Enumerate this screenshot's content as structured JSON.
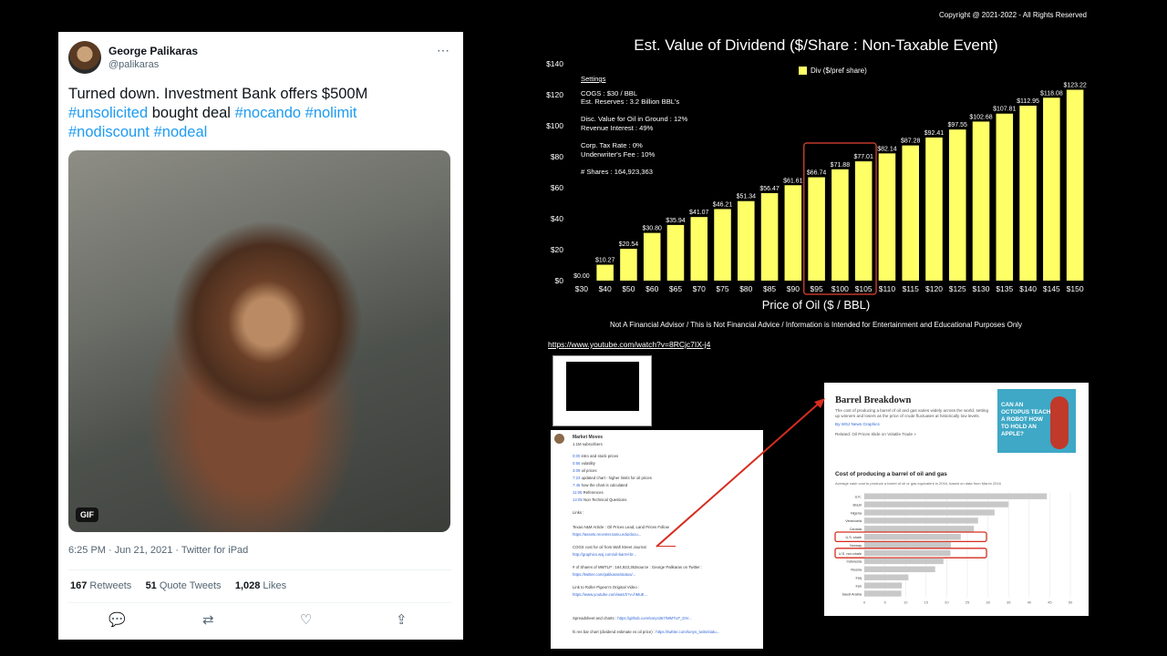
{
  "copyright": "Copyright @ 2021-2022 - All Rights Reserved",
  "tweet": {
    "name": "George Palikaras",
    "handle": "@palikaras",
    "text_plain": "Turned down.  Investment Bank offers $500M",
    "hashtags": {
      "h1": "#unsolicited",
      "mid": " bought deal ",
      "h2": "#nocando",
      "h3": "#nolimit",
      "h4": "#nodiscount",
      "h5": "#nodeal"
    },
    "gif_label": "GIF",
    "meta": "6:25 PM · Jun 21, 2021 · Twitter for iPad",
    "retweets": "167",
    "retweets_label": "Retweets",
    "quotes": "51",
    "quotes_label": "Quote Tweets",
    "likes": "1,028",
    "likes_label": "Likes",
    "more_icon": "⋯",
    "actions": {
      "reply": "💬",
      "retweet": "⇄",
      "like": "♡",
      "share": "⇪"
    }
  },
  "chart_data": {
    "type": "bar",
    "title": "Est. Value of Dividend ($/Share : Non-Taxable Event)",
    "xlabel": "Price of Oil ($ / BBL)",
    "legend": "Div ($/pref share)",
    "legend_position": "top-center",
    "categories": [
      "$30",
      "$40",
      "$50",
      "$60",
      "$65",
      "$70",
      "$75",
      "$80",
      "$85",
      "$90",
      "$95",
      "$100",
      "$105",
      "$110",
      "$115",
      "$120",
      "$125",
      "$130",
      "$135",
      "$140",
      "$145",
      "$150"
    ],
    "values": [
      0.0,
      10.27,
      20.54,
      30.8,
      35.94,
      41.07,
      46.21,
      51.34,
      56.47,
      61.61,
      66.74,
      71.88,
      77.01,
      82.14,
      87.28,
      92.41,
      97.55,
      102.68,
      107.81,
      112.95,
      118.08,
      123.22
    ],
    "value_labels": [
      "$0.00",
      "$10.27",
      "$20.54",
      "$30.80",
      "$35.94",
      "$41.07",
      "$46.21",
      "$51.34",
      "$56.47",
      "$61.61",
      "$66.74",
      "$71.88",
      "$77.01",
      "$82.14",
      "$87.28",
      "$92.41",
      "$97.55",
      "$102.68",
      "$107.81",
      "$112.95",
      "$118.08",
      "$123.22"
    ],
    "yticks": [
      "$0",
      "$20",
      "$40",
      "$60",
      "$80",
      "$100",
      "$120",
      "$140"
    ],
    "ylim": [
      0,
      140
    ],
    "bar_color": "#ffff66",
    "highlight_color": "#c0392b",
    "highlight_categories": [
      "$95",
      "$100",
      "$105"
    ],
    "grid": false
  },
  "settings": [
    "Settings",
    "COGS : $30 / BBL",
    "Est. Reserves : 3.2 Billion BBL's",
    "",
    "Disc. Value for Oil in Ground : 12%",
    "Revenue Interest : 49%",
    "",
    "Corp. Tax Rate : 0%",
    "Underwriter's Fee : 10%",
    "",
    "# Shares : 164,923,363"
  ],
  "disclaimer": "Not A Financial Advisor / This is Not Financial Advice / Information is Intended for Entertainment and Educational Purposes Only",
  "youtube_link": "https://www.youtube.com/watch?v=8RCjc7IX-j4",
  "market_moves": {
    "channel": "Market Moves",
    "subs": "1.1M subscribers",
    "lines": [
      {
        "c": "0:00",
        "t": " intro and stock prices"
      },
      {
        "c": "0:55",
        "t": " volatility"
      },
      {
        "c": "3:09",
        "t": " oil prices"
      },
      {
        "c": "7:23",
        "t": " updated chart - higher limits for oil prices"
      },
      {
        "c": "7:45",
        "t": " how the chart is calculated"
      },
      {
        "c": "11:05",
        "t": " References"
      },
      {
        "c": "14:05",
        "t": " Non Technical Questions"
      }
    ],
    "links_head": "Links :",
    "refs": [
      {
        "t": "Texas A&M Article : Oil Prices Lead, Land Prices Follow",
        "u": "https://assets.recenter.tamu.edu/docu..."
      },
      {
        "t": "COGS cost for oil from Wall Street Journal",
        "u": "http://graphics.wsj.com/oil-barrel-br..."
      },
      {
        "t": "# of Shares of MMTLP : 164,923,363source : George Palikaras on Twitter :",
        "u": "https://twitter.com/palikaras/status/..."
      },
      {
        "t": "Link to Roller Pigeon's Original Video :",
        "u": "https://www.youtube.com/watch?v=hMuE..."
      }
    ],
    "sheet": "Spreadsheet and charts : ",
    "sheet_u": "https://github.com/tonys357/MMTLP_DIV...",
    "hires": "hi res bar chart (dividend estimate vs oil price) : ",
    "hires_u": "https://twitter.com/tonys_twits/statu..."
  },
  "barrel": {
    "title": "Barrel Breakdown",
    "subtitle": "The cost of producing a barrel of oil and gas varies widely across the world, setting up winners and losers as the price of crude fluctuates at historically low levels.",
    "byline": "By WSJ News Graphics",
    "related": "Related: Oil Prices Slide on Volatile Trade »",
    "ad_text": "CAN AN OCTOPUS TEACH A ROBOT HOW TO HOLD AN APPLE?",
    "chart_title": "Cost of producing a barrel of oil and gas",
    "chart_sub": "Average cash cost to produce a barrel of oil or gas equivalent in 2016, based on data from March 2016",
    "countries": [
      "U.K.",
      "Brazil",
      "Nigeria",
      "Venezuela",
      "Canada",
      "U.S. shale",
      "Norway",
      "U.S. non-shale",
      "Indonesia",
      "Russia",
      "Iraq",
      "Iran",
      "Saudi Arabia"
    ],
    "values": [
      44.3,
      35.0,
      31.6,
      27.6,
      26.6,
      23.4,
      21.0,
      20.9,
      19.2,
      17.2,
      10.7,
      9.1,
      8.98
    ],
    "xticks": [
      "0",
      "5",
      "10",
      "15",
      "20",
      "25",
      "30",
      "35",
      "40",
      "45",
      "50"
    ],
    "highlight": [
      "U.S. shale",
      "U.S. non-shale"
    ]
  }
}
